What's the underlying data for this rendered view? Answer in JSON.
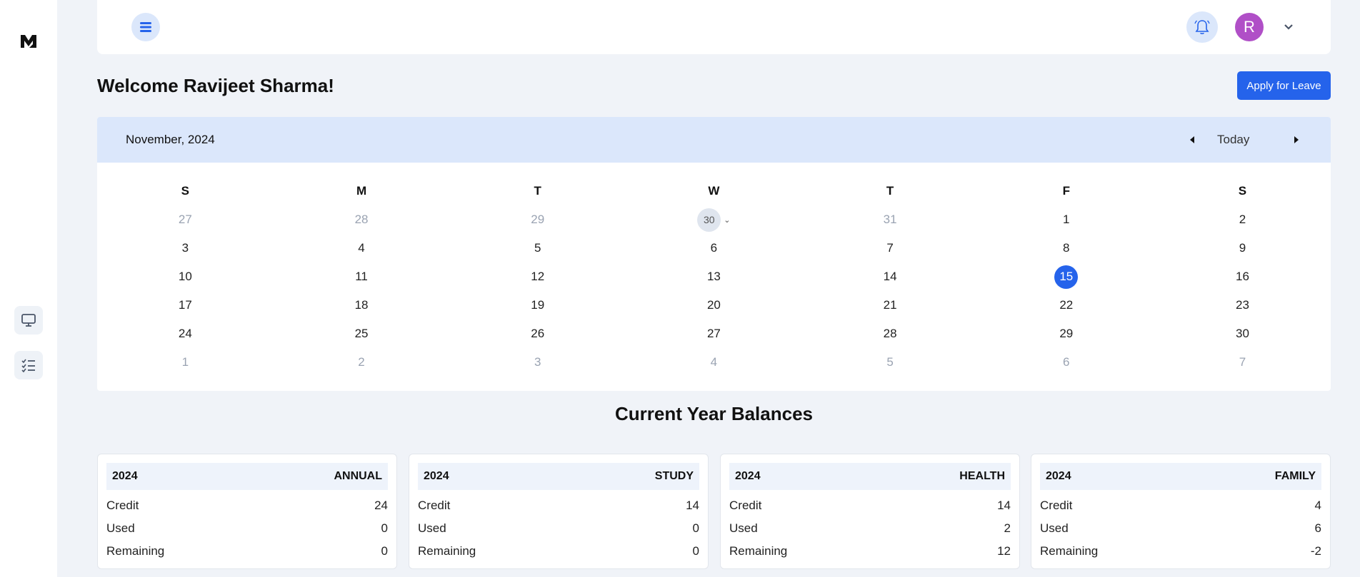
{
  "header": {
    "avatar_initial": "R"
  },
  "sidebar": {
    "items": [
      {
        "icon": "monitor-icon"
      },
      {
        "icon": "checklist-icon"
      }
    ]
  },
  "welcome": "Welcome Ravijeet Sharma!",
  "apply_button": "Apply for Leave",
  "calendar": {
    "month_label": "November, 2024",
    "today_label": "Today",
    "weekdays": [
      "S",
      "M",
      "T",
      "W",
      "T",
      "F",
      "S"
    ],
    "weeks": [
      [
        "27",
        "28",
        "29",
        "30",
        "31",
        "1",
        "2"
      ],
      [
        "3",
        "4",
        "5",
        "6",
        "7",
        "8",
        "9"
      ],
      [
        "10",
        "11",
        "12",
        "13",
        "14",
        "15",
        "16"
      ],
      [
        "17",
        "18",
        "19",
        "20",
        "21",
        "22",
        "23"
      ],
      [
        "24",
        "25",
        "26",
        "27",
        "28",
        "29",
        "30"
      ],
      [
        "1",
        "2",
        "3",
        "4",
        "5",
        "6",
        "7"
      ]
    ]
  },
  "balances": {
    "title": "Current Year Balances",
    "cards": [
      {
        "year": "2024",
        "type": "ANNUAL",
        "rows": [
          {
            "label": "Credit",
            "value": "24"
          },
          {
            "label": "Used",
            "value": "0"
          },
          {
            "label": "Remaining",
            "value": "0"
          }
        ]
      },
      {
        "year": "2024",
        "type": "STUDY",
        "rows": [
          {
            "label": "Credit",
            "value": "14"
          },
          {
            "label": "Used",
            "value": "0"
          },
          {
            "label": "Remaining",
            "value": "0"
          }
        ]
      },
      {
        "year": "2024",
        "type": "HEALTH",
        "rows": [
          {
            "label": "Credit",
            "value": "14"
          },
          {
            "label": "Used",
            "value": "2"
          },
          {
            "label": "Remaining",
            "value": "12"
          }
        ]
      },
      {
        "year": "2024",
        "type": "FAMILY",
        "rows": [
          {
            "label": "Credit",
            "value": "4"
          },
          {
            "label": "Used",
            "value": "6"
          },
          {
            "label": "Remaining",
            "value": "-2"
          }
        ]
      }
    ]
  }
}
